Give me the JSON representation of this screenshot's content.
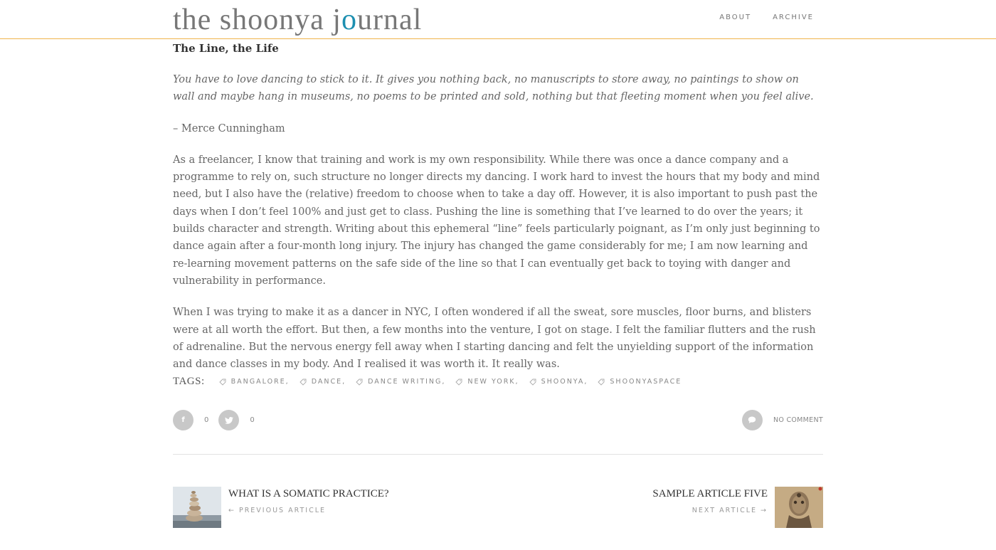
{
  "header": {
    "logo_part1": "the shoonya j",
    "logo_accent": "o",
    "logo_part2": "urnal",
    "nav": [
      "ABOUT",
      "ARCHIVE"
    ]
  },
  "post": {
    "title": "The Line, the Life",
    "quote": "You have to love dancing to stick to it. It gives you nothing back, no manuscripts to store away, no paintings to show on wall and maybe hang in museums, no poems to be printed and sold, nothing but that fleeting moment when you feel alive.",
    "attribution": "– Merce Cunningham",
    "paragraphs": [
      "As a freelancer, I know that training and work is my own responsibility. While there was once a dance company and a programme to rely on, such structure no longer directs my dancing. I work hard to invest the hours that my body and mind need, but I also have the (relative) freedom to choose when to take a day off. However, it is also important to push past the days when I don’t feel 100% and just get to class. Pushing the line is something that I’ve learned to do over the years; it builds character and strength. Writing about this ephemeral “line” feels particularly poignant, as I’m only just beginning to dance again after a four-month long injury. The injury has changed the game considerably for me; I am now learning and re-learning movement patterns on the safe side of the line so that I can eventually get back to toying with danger and vulnerability in performance.",
      "When I was trying to make it as a dancer in NYC, I often wondered if all the sweat, sore muscles, floor burns, and blisters were at all worth the effort. But then, a few months into the venture, I got on stage. I felt the familiar flutters and the rush of adrenaline. But the nervous energy fell away when I starting dancing and felt the unyielding support of the information and dance classes in my body. And I realised it was worth it. It really was."
    ]
  },
  "tags": {
    "label": "TAGS:",
    "items": [
      "BANGALORE,",
      "DANCE,",
      "DANCE WRITING,",
      "NEW YORK,",
      "SHOONYA,",
      "SHOONYASPACE"
    ],
    "icon": "tag-icon"
  },
  "social": {
    "facebook_icon": "f",
    "facebook_count": "0",
    "twitter_count": "0"
  },
  "comments": {
    "label": "NO COMMENT"
  },
  "navigation": {
    "prev_title": "WHAT IS A SOMATIC PRACTICE?",
    "prev_label": "← PREVIOUS ARTICLE",
    "next_title": "SAMPLE ARTICLE FIVE",
    "next_label": "NEXT ARTICLE →"
  },
  "colors": {
    "accent": "#1c8fb0",
    "header_border": "#f0b34a",
    "button_grey": "#c8c8c8"
  }
}
